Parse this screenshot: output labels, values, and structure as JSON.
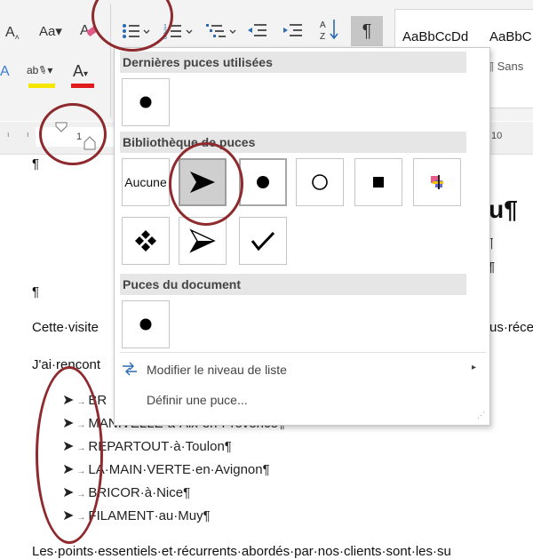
{
  "ribbon": {
    "font_size_label": "Aa",
    "font_size_icon": "font-grow-icon",
    "styles": {
      "preview_1": "AaBbCcDd",
      "preview_2": "AaBbC",
      "style_name_partial": "¶ Sans"
    },
    "highlight_color": "#f5e600",
    "font_color": "#e01b1b",
    "pilcrow_label": "¶"
  },
  "ruler": {
    "marker_label": "1",
    "right_label": "10"
  },
  "menu": {
    "recent_header": "Dernières puces utilisées",
    "library_header": "Bibliothèque de puces",
    "none_label": "Aucune",
    "document_header": "Puces du document",
    "change_level_label": "Modifier le niveau de liste",
    "define_label": "Définir une puce..."
  },
  "document": {
    "pilcrow": "¶",
    "heading_fragment": "ou¶",
    "line_fragment_1": "d¶",
    "line_fragment_2": "¶",
    "para_1_start": "Cette·visite",
    "para_1_end": "us·réce",
    "para_2_start": "J'ai·rencont",
    "list": [
      "BR",
      "MANIVELLE·à·Aix-en-Provence¶",
      "REPARTOUT·à·Toulon¶",
      "LA·MAIN·VERTE·en·Avignon¶",
      "BRICOR·à·Nice¶",
      "FILAMENT·au·Muy¶"
    ],
    "bottom_line": "Les·points·essentiels·et·récurrents·abordés·par·nos·clients·sont·les·su"
  },
  "annotation_color": "#8e2a2e"
}
